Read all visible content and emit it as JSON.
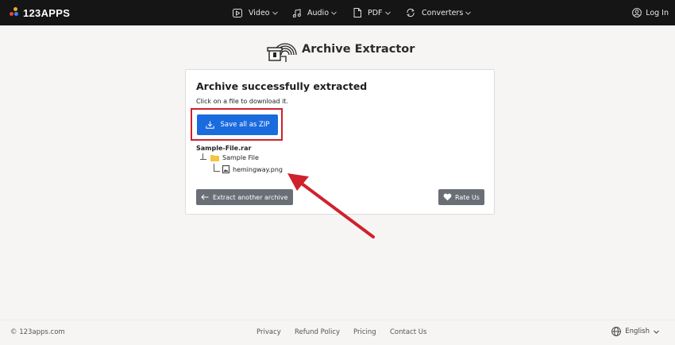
{
  "brand": {
    "logo_text": "123APPS",
    "dot_colors": [
      "#f6a623",
      "#e8443a",
      "#3b82f6",
      "#ffffff"
    ]
  },
  "nav": [
    {
      "label": "Video",
      "icon": "play-square-icon"
    },
    {
      "label": "Audio",
      "icon": "music-note-icon"
    },
    {
      "label": "PDF",
      "icon": "document-icon"
    },
    {
      "label": "Converters",
      "icon": "refresh-icon"
    }
  ],
  "login_label": "Log In",
  "app": {
    "title": "Archive Extractor",
    "icon": "archive-extractor-logo"
  },
  "card": {
    "title": "Archive successfully extracted",
    "subtitle": "Click on a file to download it.",
    "save_label": "Save all as ZIP",
    "tree": {
      "root": "Sample-File.rar",
      "folder": "Sample File",
      "file": "hemingway.png"
    },
    "extract_another_label": "Extract another archive",
    "rate_label": "Rate Us"
  },
  "colors": {
    "accent": "#1a6bde",
    "annotation": "#d0212c",
    "nav_bg": "#151515",
    "button_gray": "#6a6f76",
    "folder": "#f4c542"
  },
  "footer": {
    "copyright": "© 123apps.com",
    "links": [
      "Privacy",
      "Refund Policy",
      "Pricing",
      "Contact Us"
    ],
    "language": "English"
  }
}
